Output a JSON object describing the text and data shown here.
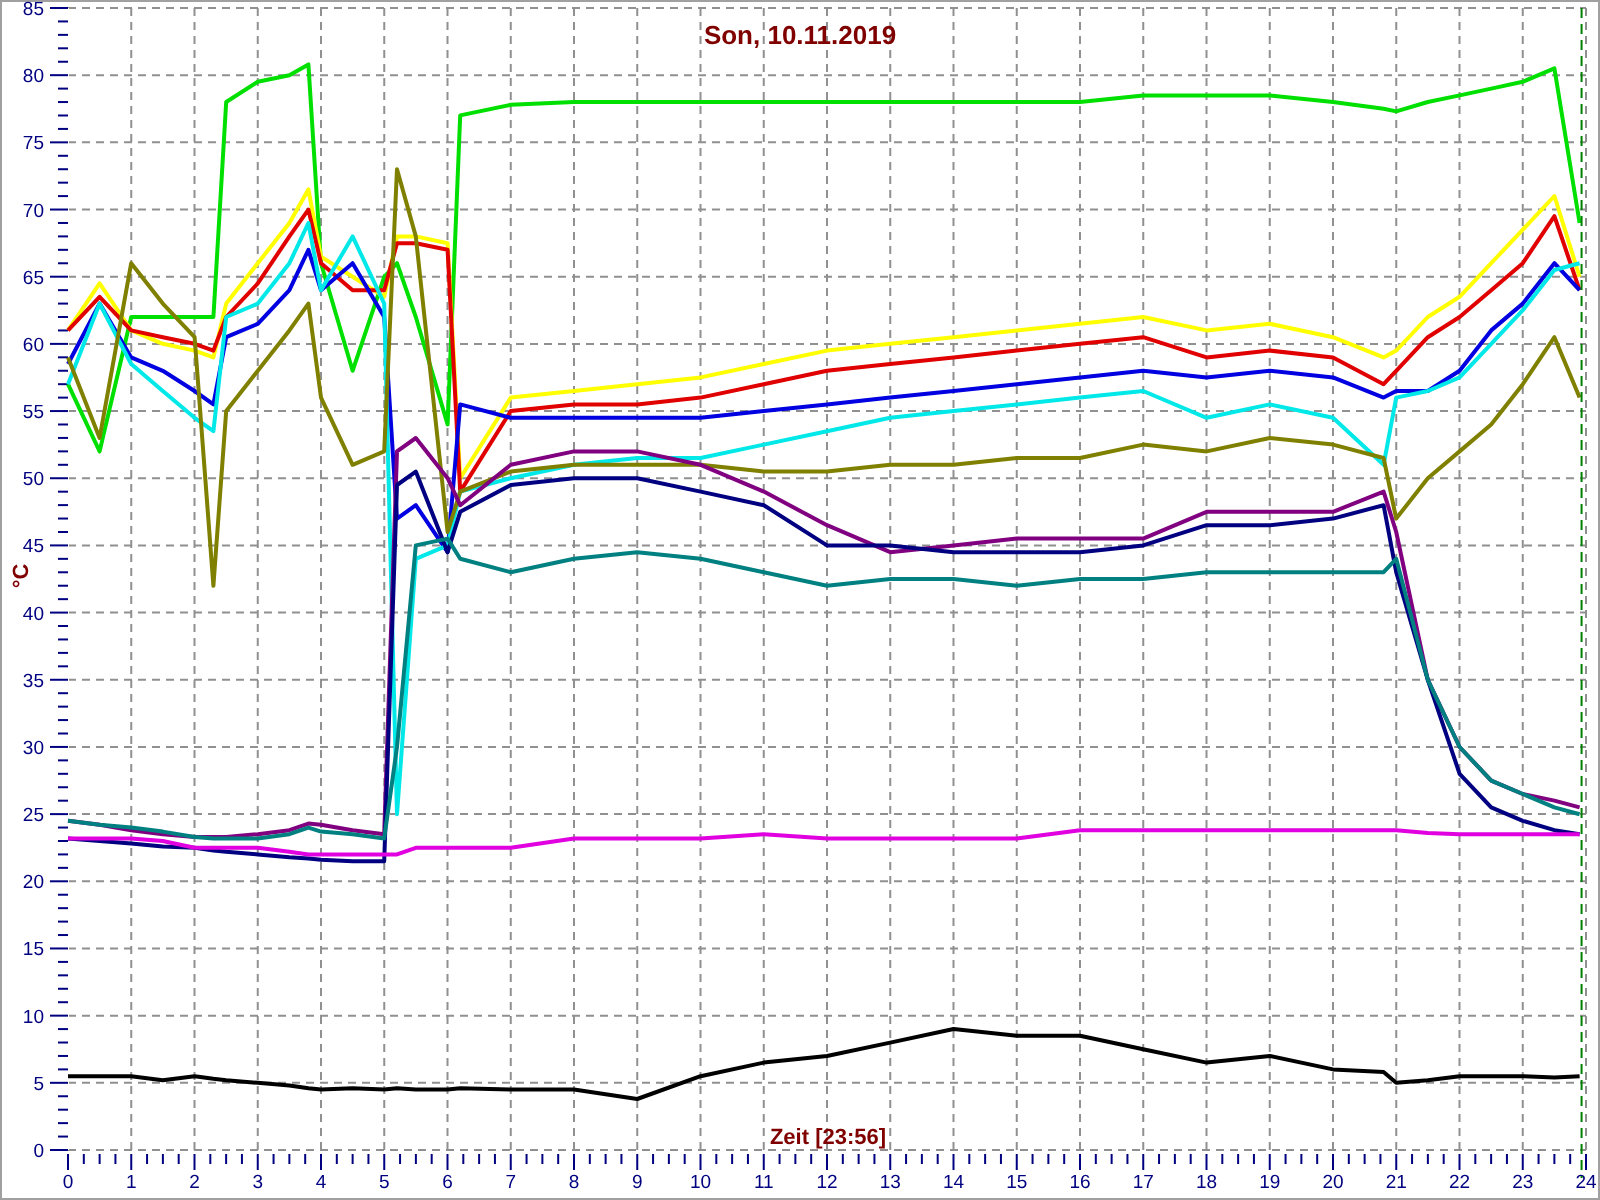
{
  "chart_data": {
    "type": "line",
    "title": "Son, 10.11.2019",
    "xlabel": "Zeit [23:56]",
    "ylabel": "°C",
    "x": [
      0,
      0.5,
      1,
      1.5,
      2,
      2.3,
      2.5,
      3,
      3.5,
      3.8,
      4,
      4.5,
      5,
      5.2,
      5.5,
      6,
      6.2,
      7,
      8,
      9,
      10,
      11,
      12,
      13,
      14,
      15,
      16,
      17,
      18,
      19,
      20,
      20.8,
      21,
      21.5,
      22,
      22.5,
      23,
      23.5,
      23.9
    ],
    "xlim": [
      0,
      24
    ],
    "ylim": [
      0,
      85
    ],
    "xticks": [
      0,
      1,
      2,
      3,
      4,
      5,
      6,
      7,
      8,
      9,
      10,
      11,
      12,
      13,
      14,
      15,
      16,
      17,
      18,
      19,
      20,
      21,
      22,
      23,
      24
    ],
    "yticks": [
      0,
      5,
      10,
      15,
      20,
      25,
      30,
      35,
      40,
      45,
      50,
      55,
      60,
      65,
      70,
      75,
      80,
      85
    ],
    "series": [
      {
        "color": "#00e000",
        "values": [
          57,
          52,
          62,
          62,
          62,
          62,
          78,
          79.5,
          80,
          80.8,
          66,
          58,
          65,
          66,
          62,
          54,
          77,
          77.8,
          78,
          78,
          78,
          78,
          78,
          78,
          78,
          78,
          78,
          78.5,
          78.5,
          78.5,
          78,
          77.5,
          77.3,
          78,
          78.5,
          79,
          79.5,
          80.5,
          69
        ]
      },
      {
        "color": "#ffff00",
        "values": [
          61,
          64.5,
          61,
          60,
          59.5,
          59,
          63,
          66,
          69,
          71.5,
          66.5,
          65,
          63.5,
          68,
          68,
          67.5,
          50,
          56,
          56.5,
          57,
          57.5,
          58.5,
          59.5,
          60,
          60.5,
          61,
          61.5,
          62,
          61,
          61.5,
          60.5,
          59,
          59.5,
          62,
          63.5,
          66,
          68.5,
          71,
          65
        ]
      },
      {
        "color": "#e00000",
        "values": [
          61,
          63.5,
          61,
          60.5,
          60,
          59.5,
          62,
          64.5,
          68,
          70,
          66,
          64,
          64,
          67.5,
          67.5,
          67,
          49,
          55,
          55.5,
          55.5,
          56,
          57,
          58,
          58.5,
          59,
          59.5,
          60,
          60.5,
          59,
          59.5,
          59,
          57,
          58,
          60.5,
          62,
          64,
          66,
          69.5,
          64
        ]
      },
      {
        "color": "#0000e0",
        "values": [
          58.5,
          63,
          59,
          58,
          56.5,
          55.5,
          60.5,
          61.5,
          64,
          67,
          64,
          66,
          62,
          47,
          48,
          44.5,
          55.5,
          54.5,
          54.5,
          54.5,
          54.5,
          55,
          55.5,
          56,
          56.5,
          57,
          57.5,
          58,
          57.5,
          58,
          57.5,
          56,
          56.5,
          56.5,
          58,
          61,
          63,
          66,
          64
        ]
      },
      {
        "color": "#00e8e8",
        "values": [
          57,
          63,
          58.5,
          56.5,
          54.5,
          53.5,
          62,
          63,
          66,
          69,
          64,
          68,
          63,
          25,
          44,
          45,
          49,
          50,
          51,
          51.5,
          51.5,
          52.5,
          53.5,
          54.5,
          55,
          55.5,
          56,
          56.5,
          54.5,
          55.5,
          54.5,
          51,
          56,
          56.5,
          57.5,
          60,
          62.5,
          65.5,
          66
        ]
      },
      {
        "color": "#808000",
        "values": [
          59,
          53,
          66,
          63,
          60.5,
          42,
          55,
          58,
          61,
          63,
          56,
          51,
          52,
          73,
          68,
          46,
          49,
          50.5,
          51,
          51,
          51,
          50.5,
          50.5,
          51,
          51,
          51.5,
          51.5,
          52.5,
          52,
          53,
          52.5,
          51.5,
          47,
          50,
          52,
          54,
          57,
          60.5,
          56
        ]
      },
      {
        "color": "#800080",
        "values": [
          24.5,
          24.2,
          23.8,
          23.5,
          23.3,
          23.3,
          23.3,
          23.5,
          23.8,
          24.3,
          24.2,
          23.8,
          23.5,
          52,
          53,
          50,
          48,
          51,
          52,
          52,
          51,
          49,
          46.5,
          44.5,
          45,
          45.5,
          45.5,
          45.5,
          47.5,
          47.5,
          47.5,
          49,
          46,
          35,
          30,
          27.5,
          26.5,
          26,
          25.5
        ]
      },
      {
        "color": "#000080",
        "values": [
          23.2,
          23,
          22.8,
          22.6,
          22.5,
          22.3,
          22.2,
          22,
          21.8,
          21.7,
          21.6,
          21.5,
          21.5,
          49.5,
          50.5,
          44.5,
          47.5,
          49.5,
          50,
          50,
          49,
          48,
          45,
          45,
          44.5,
          44.5,
          44.5,
          45,
          46.5,
          46.5,
          47,
          48,
          43,
          35,
          28,
          25.5,
          24.5,
          23.8,
          23.5
        ]
      },
      {
        "color": "#008080",
        "values": [
          24.5,
          24.2,
          24,
          23.7,
          23.3,
          23.2,
          23.2,
          23.2,
          23.5,
          24,
          23.7,
          23.5,
          23.2,
          30,
          45,
          45.5,
          44,
          43,
          44,
          44.5,
          44,
          43,
          42,
          42.5,
          42.5,
          42,
          42.5,
          42.5,
          43,
          43,
          43,
          43,
          44,
          35,
          30,
          27.5,
          26.5,
          25.5,
          25
        ]
      },
      {
        "color": "#e000e0",
        "values": [
          23.2,
          23.2,
          23.2,
          23,
          22.5,
          22.5,
          22.5,
          22.5,
          22.2,
          22,
          22,
          22,
          22,
          22,
          22.5,
          22.5,
          22.5,
          22.5,
          23.2,
          23.2,
          23.2,
          23.5,
          23.2,
          23.2,
          23.2,
          23.2,
          23.8,
          23.8,
          23.8,
          23.8,
          23.8,
          23.8,
          23.8,
          23.6,
          23.5,
          23.5,
          23.5,
          23.5,
          23.5
        ]
      },
      {
        "color": "#000000",
        "values": [
          5.5,
          5.5,
          5.5,
          5.2,
          5.5,
          5.3,
          5.2,
          5,
          4.8,
          4.6,
          4.5,
          4.6,
          4.5,
          4.6,
          4.5,
          4.5,
          4.6,
          4.5,
          4.5,
          3.8,
          5.5,
          6.5,
          7,
          8,
          9,
          8.5,
          8.5,
          7.5,
          6.5,
          7,
          6,
          5.8,
          5,
          5.2,
          5.5,
          5.5,
          5.5,
          5.4,
          5.5
        ]
      }
    ],
    "grid": true,
    "ref_lines": [
      {
        "axis": "x",
        "value": 23.93,
        "color": "#008000"
      }
    ]
  }
}
